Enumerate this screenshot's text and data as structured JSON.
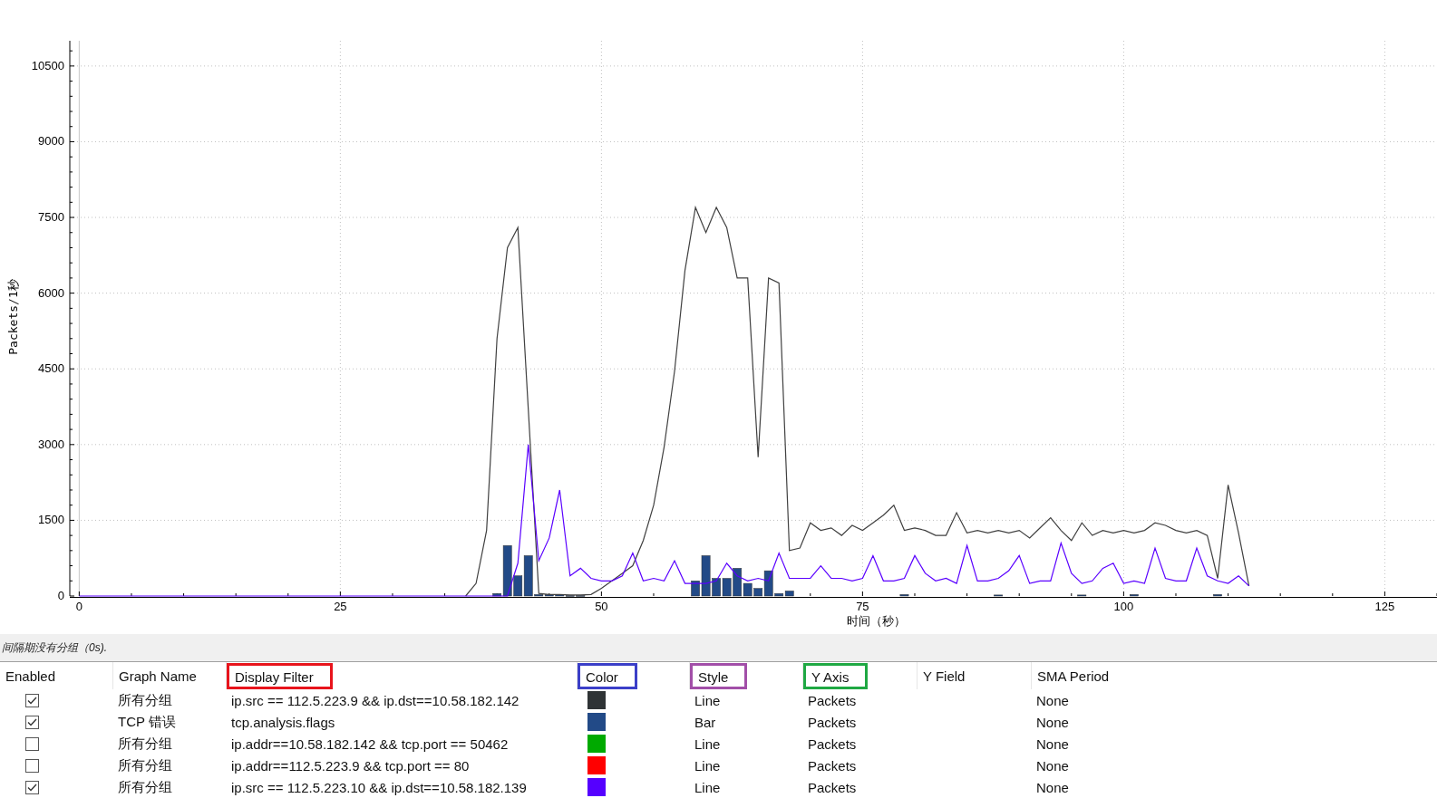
{
  "chart": {
    "chart_data": {
      "type": "line",
      "xlabel": "时间（秒）",
      "ylabel": "Packets/1秒",
      "xlim": [
        -0.9,
        130
      ],
      "ylim": [
        0,
        11000
      ],
      "grid": true,
      "xticks": [
        0,
        25,
        50,
        75,
        100,
        125
      ],
      "yticks": [
        0,
        1500,
        3000,
        4500,
        6000,
        7500,
        9000,
        10500
      ],
      "x": [
        0,
        1,
        2,
        3,
        4,
        5,
        6,
        7,
        8,
        9,
        10,
        11,
        12,
        13,
        14,
        15,
        16,
        17,
        18,
        19,
        20,
        21,
        22,
        23,
        24,
        25,
        26,
        27,
        28,
        29,
        30,
        31,
        32,
        33,
        34,
        35,
        36,
        37,
        38,
        39,
        40,
        41,
        42,
        43,
        44,
        45,
        46,
        47,
        48,
        49,
        50,
        51,
        52,
        53,
        54,
        55,
        56,
        57,
        58,
        59,
        60,
        61,
        62,
        63,
        64,
        65,
        66,
        67,
        68,
        69,
        70,
        71,
        72,
        73,
        74,
        75,
        76,
        77,
        78,
        79,
        80,
        81,
        82,
        83,
        84,
        85,
        86,
        87,
        88,
        89,
        90,
        91,
        92,
        93,
        94,
        95,
        96,
        97,
        98,
        99,
        100,
        101,
        102,
        103,
        104,
        105,
        106,
        107,
        108,
        109,
        110,
        111,
        112
      ],
      "series": [
        {
          "color": "#404040",
          "values": [
            null,
            null,
            null,
            null,
            null,
            null,
            null,
            null,
            null,
            null,
            null,
            null,
            null,
            null,
            null,
            null,
            null,
            null,
            null,
            null,
            null,
            null,
            null,
            null,
            null,
            null,
            null,
            null,
            null,
            null,
            null,
            null,
            null,
            null,
            null,
            null,
            null,
            0,
            250,
            1300,
            5100,
            6900,
            7300,
            3700,
            50,
            30,
            30,
            20,
            20,
            30,
            150,
            300,
            450,
            600,
            1100,
            1800,
            2950,
            4450,
            6450,
            7700,
            7200,
            7700,
            7300,
            6300,
            6300,
            2750,
            6300,
            6200,
            900,
            950,
            1450,
            1300,
            1350,
            1200,
            1400,
            1300,
            1450,
            1600,
            1800,
            1300,
            1350,
            1300,
            1200,
            1200,
            1650,
            1250,
            1300,
            1250,
            1300,
            1250,
            1300,
            1150,
            1350,
            1550,
            1300,
            1100,
            1450,
            1200,
            1300,
            1250,
            1300,
            1250,
            1300,
            1450,
            1400,
            1300,
            1250,
            1300,
            1200,
            350,
            2200,
            1250,
            200
          ]
        },
        {
          "color": "#5a00ff",
          "values": [
            0,
            0,
            0,
            0,
            0,
            0,
            0,
            0,
            0,
            0,
            0,
            0,
            0,
            0,
            0,
            0,
            0,
            0,
            0,
            0,
            0,
            0,
            0,
            0,
            0,
            0,
            0,
            0,
            0,
            0,
            0,
            0,
            0,
            0,
            0,
            0,
            0,
            0,
            0,
            0,
            0,
            0,
            650,
            3000,
            700,
            1150,
            2100,
            400,
            550,
            350,
            300,
            300,
            400,
            850,
            300,
            350,
            300,
            700,
            250,
            250,
            250,
            300,
            650,
            400,
            300,
            350,
            300,
            850,
            350,
            350,
            350,
            600,
            350,
            350,
            300,
            350,
            800,
            300,
            300,
            350,
            800,
            450,
            300,
            350,
            250,
            1000,
            300,
            300,
            350,
            500,
            800,
            250,
            300,
            300,
            1050,
            450,
            250,
            300,
            550,
            650,
            250,
            300,
            250,
            950,
            350,
            300,
            300,
            950,
            400,
            300,
            250,
            400,
            200
          ]
        },
        {
          "type": "bar",
          "color": "#224a87",
          "values": [
            null,
            null,
            null,
            null,
            null,
            null,
            null,
            null,
            null,
            null,
            null,
            null,
            null,
            null,
            null,
            null,
            null,
            null,
            null,
            null,
            null,
            null,
            null,
            null,
            null,
            null,
            null,
            null,
            null,
            null,
            null,
            null,
            null,
            null,
            null,
            null,
            null,
            null,
            null,
            null,
            50,
            1000,
            400,
            800,
            30,
            30,
            30,
            10,
            10,
            null,
            null,
            null,
            null,
            null,
            null,
            null,
            null,
            null,
            null,
            300,
            800,
            350,
            350,
            550,
            250,
            150,
            500,
            50,
            100,
            null,
            null,
            null,
            null,
            null,
            null,
            null,
            null,
            null,
            null,
            30,
            null,
            null,
            null,
            null,
            null,
            null,
            null,
            null,
            20,
            null,
            null,
            null,
            null,
            null,
            null,
            null,
            20,
            null,
            null,
            null,
            null,
            30,
            null,
            null,
            null,
            null,
            null,
            null,
            null,
            30,
            null,
            null,
            null
          ]
        }
      ]
    }
  },
  "status": "间隔期没有分组（0s).",
  "table": {
    "columns": [
      {
        "label": "Enabled"
      },
      {
        "label": "Graph Name"
      },
      {
        "label": "Display Filter",
        "color": "#e8141c"
      },
      {
        "label": "Color",
        "color": "#3b3fc8"
      },
      {
        "label": "Style",
        "color": "#a24fa8"
      },
      {
        "label": "Y Axis",
        "color": "#1fa843"
      },
      {
        "label": "Y Field"
      },
      {
        "label": "SMA Period"
      }
    ],
    "rows": [
      {
        "enabled": true,
        "name": "所有分组",
        "filter": "ip.src == 112.5.223.9 && ip.dst==10.58.182.142",
        "color": "#2f3335",
        "style": "Line",
        "y_axis": "Packets",
        "sma": "None"
      },
      {
        "enabled": true,
        "name": "TCP 错误",
        "filter": "tcp.analysis.flags",
        "color": "#224a87",
        "style": "Bar",
        "y_axis": "Packets",
        "sma": "None"
      },
      {
        "enabled": false,
        "name": "所有分组",
        "filter": "ip.addr==10.58.182.142 && tcp.port == 50462",
        "color": "#00aa00",
        "style": "Line",
        "y_axis": "Packets",
        "sma": "None"
      },
      {
        "enabled": false,
        "name": "所有分组",
        "filter": "ip.addr==112.5.223.9 && tcp.port == 80",
        "color": "#ff0000",
        "style": "Line",
        "y_axis": "Packets",
        "sma": "None"
      },
      {
        "enabled": true,
        "name": "所有分组",
        "filter": "ip.src == 112.5.223.10 && ip.dst==10.58.182.139",
        "color": "#5500ff",
        "style": "Line",
        "y_axis": "Packets",
        "sma": "None"
      }
    ]
  }
}
